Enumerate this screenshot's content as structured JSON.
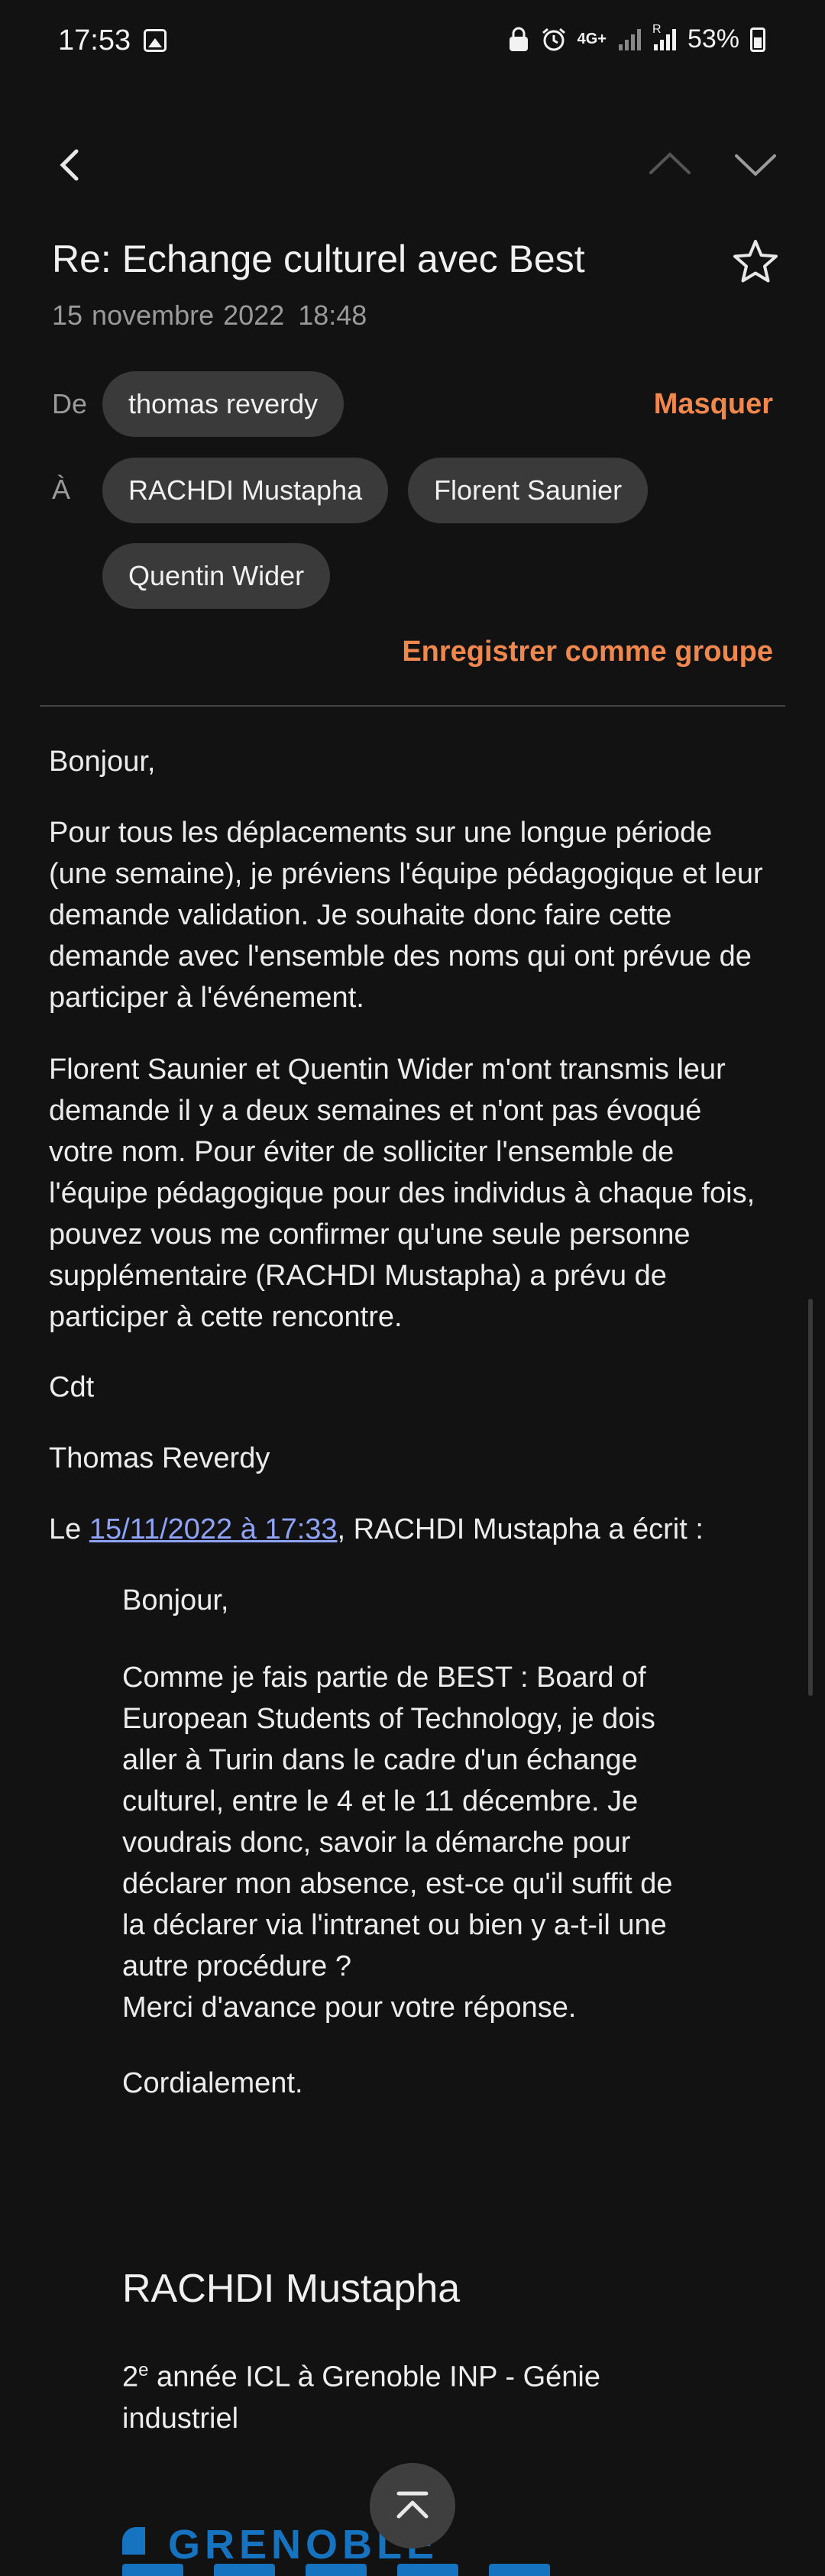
{
  "status": {
    "time": "17:53",
    "network": "4G+",
    "sim_label": "R",
    "battery": "53%"
  },
  "email": {
    "subject": "Re: Echange culturel avec Best",
    "date": "15 novembre 2022",
    "time": "18:48",
    "from_label": "De",
    "from": "thomas reverdy",
    "hide_label": "Masquer",
    "to_label": "À",
    "to": [
      "RACHDI Mustapha",
      "Florent Saunier",
      "Quentin Wider"
    ],
    "save_group_label": "Enregistrer comme groupe"
  },
  "message": {
    "greeting": "Bonjour,",
    "p1": "Pour tous les déplacements sur une longue période (une semaine), je préviens l'équipe pédagogique et leur demande validation. Je souhaite donc faire cette demande avec l'ensemble des noms qui ont prévue de participer à l'événement.",
    "p2": "Florent Saunier et Quentin Wider m'ont transmis leur demande il y a deux semaines et n'ont pas évoqué votre nom. Pour éviter de solliciter l'ensemble de l'équipe pédagogique pour des individus à chaque fois, pouvez vous me confirmer qu'une seule personne supplémentaire (RACHDI Mustapha) a prévu de participer à cette rencontre.",
    "closing": "Cdt",
    "signature": "Thomas Reverdy",
    "quote_prefix": "Le ",
    "quote_link": "15/11/2022 à 17:33",
    "quote_suffix": ", RACHDI Mustapha a écrit :"
  },
  "quoted": {
    "greeting": "Bonjour,",
    "body": "Comme je fais partie de BEST : Board of European Students of Technology, je dois aller à Turin dans le cadre d'un échange culturel, entre le 4 et le 11 décembre. Je voudrais donc, savoir la démarche pour déclarer mon absence, est-ce qu'il suffit de la déclarer via l'intranet ou bien y a-t-il une autre procédure ?",
    "thanks": "Merci d'avance pour votre réponse.",
    "closing": "Cordialement.",
    "sig_name": "RACHDI Mustapha",
    "sig_role_pre": "2",
    "sig_role_sup": "e",
    "sig_role_post": " année ICL à Grenoble INP - Génie industriel",
    "logo_text": "GRENOBLE"
  },
  "colors": {
    "accent": "#f0884e",
    "link": "#8fa2f5",
    "background": "#121212",
    "chip": "#3a3a3a",
    "logo": "#1673c0"
  }
}
